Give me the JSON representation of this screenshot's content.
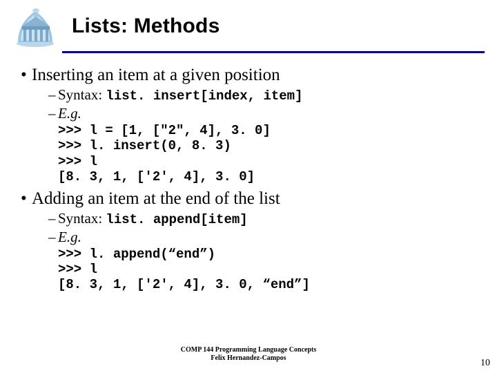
{
  "header": {
    "title": "Lists: Methods"
  },
  "section1": {
    "bullet": "Inserting an item at a given position",
    "syntax_label": "Syntax:",
    "syntax_code": "list. insert[index, item]",
    "eg_label": "E.g.",
    "code": ">>> l = [1, [\"2\", 4], 3. 0]\n>>> l. insert(0, 8. 3)\n>>> l\n[8. 3, 1, ['2', 4], 3. 0]"
  },
  "section2": {
    "bullet": "Adding an item at the end of the list",
    "syntax_label": "Syntax:",
    "syntax_code": "list. append[item]",
    "eg_label": "E.g.",
    "code": ">>> l. append(“end”)\n>>> l\n[8. 3, 1, ['2', 4], 3. 0, “end”]"
  },
  "footer": {
    "line1": "COMP 144 Programming Language Concepts",
    "line2": "Felix Hernandez-Campos"
  },
  "page_number": "10"
}
